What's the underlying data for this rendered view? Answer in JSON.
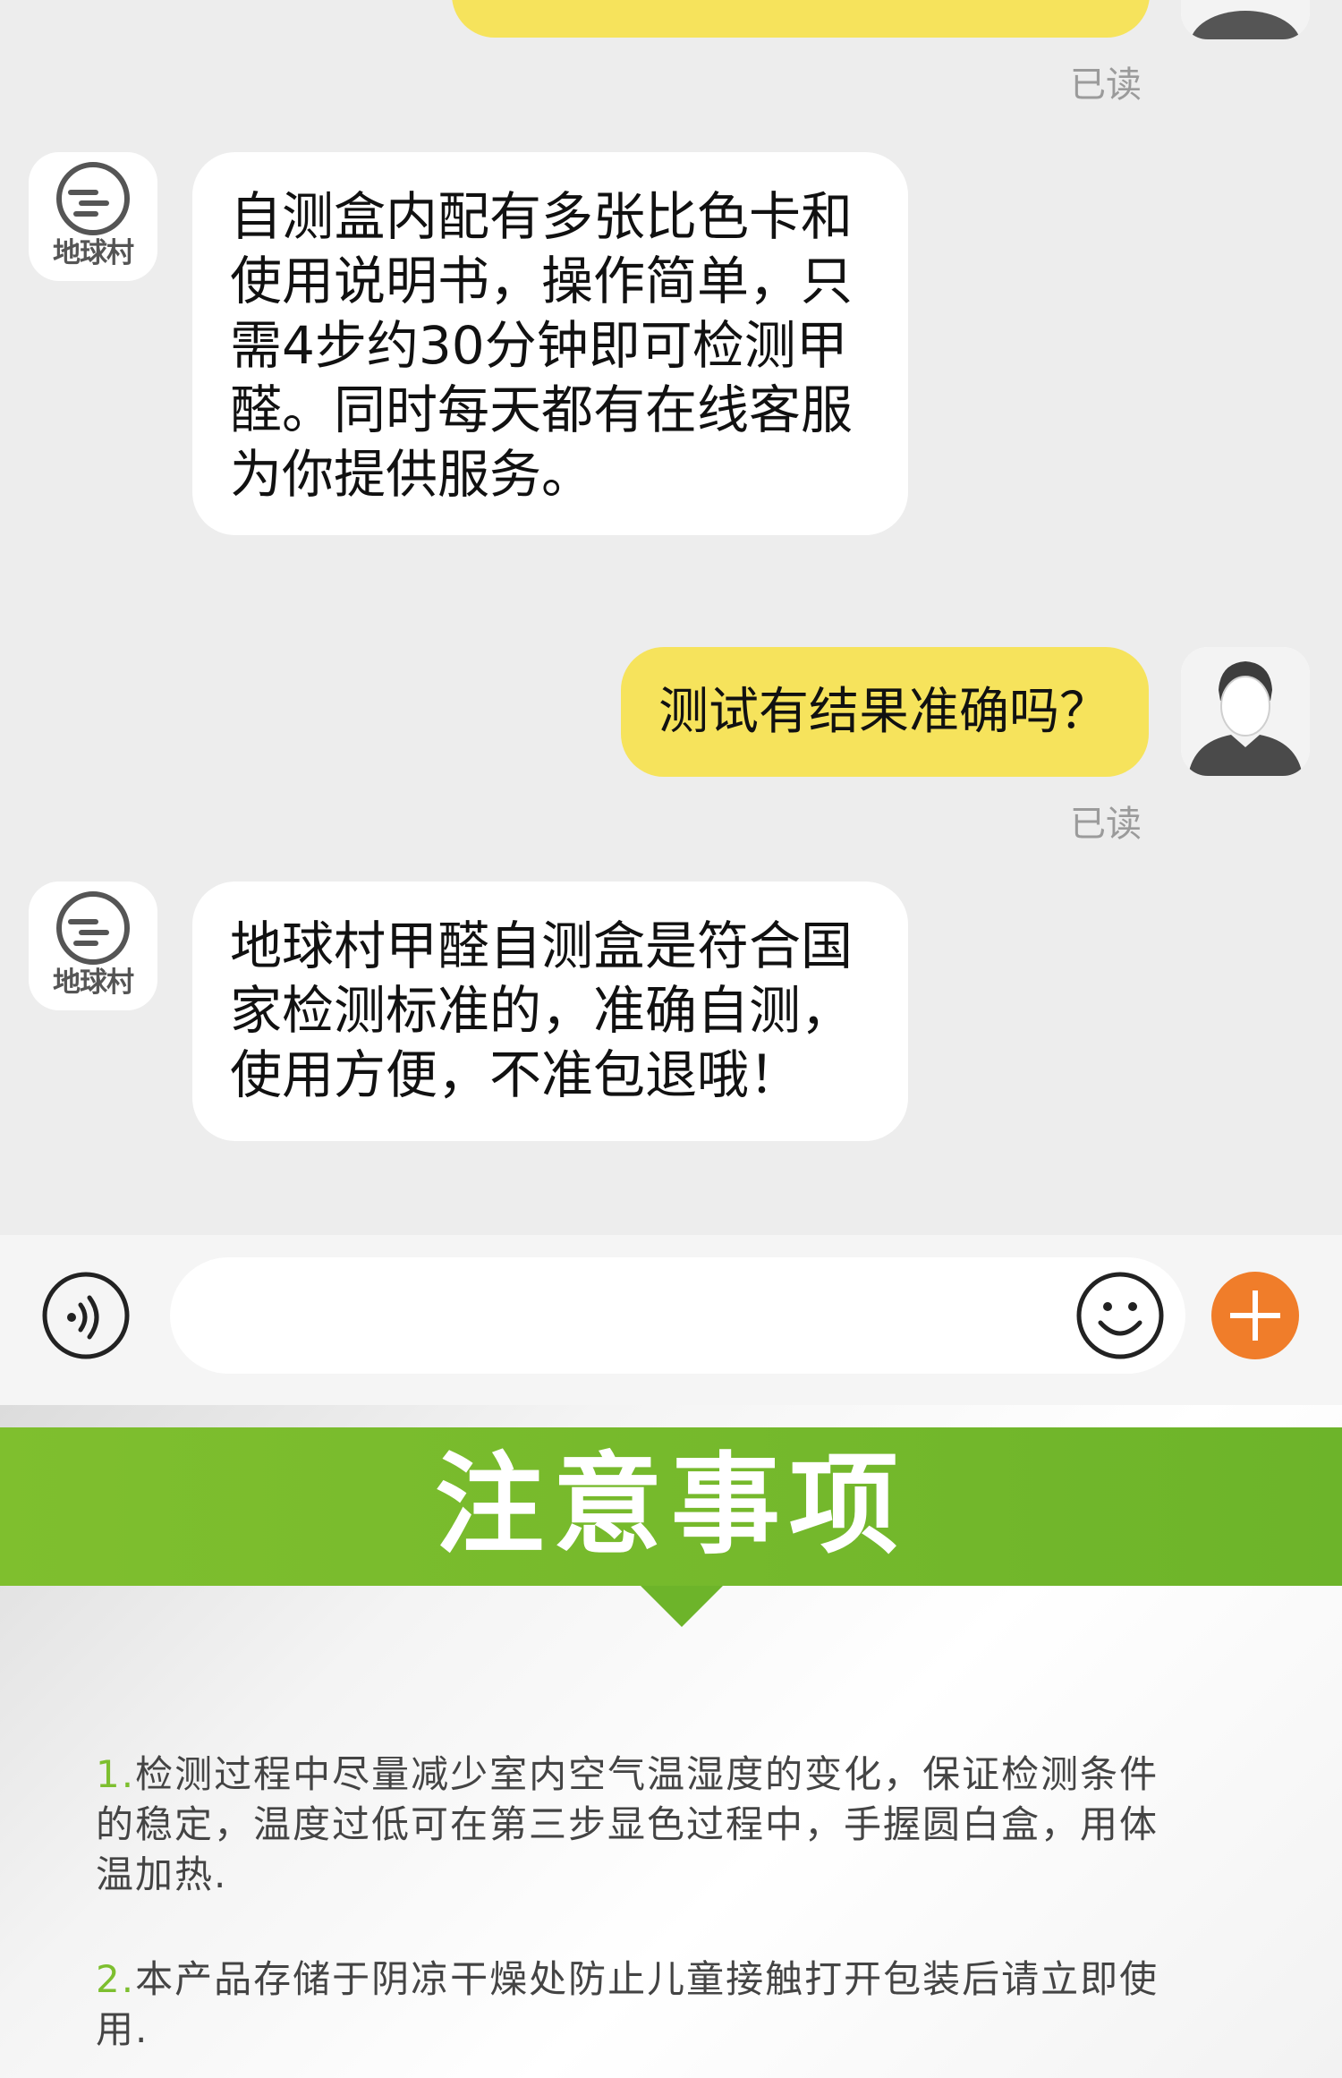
{
  "chat": {
    "messages": [
      {
        "from": "user",
        "text": "",
        "status": "已读"
      },
      {
        "from": "bot",
        "avatar_logo_text": "地球村",
        "lines": [
          "自测盒内配有多张比色卡和",
          "使用说明书，操作简单，只",
          "需4步约30分钟即可检测甲",
          "醛。同时每天都有在线客服",
          "为你提供服务。"
        ]
      },
      {
        "from": "user",
        "text": "测试有结果准确吗？",
        "status": "已读"
      },
      {
        "from": "bot",
        "avatar_logo_text": "地球村",
        "lines": [
          "地球村甲醛自测盒是符合国",
          "家检测标准的，准确自测，",
          "使用方便，不准包退哦！"
        ]
      }
    ]
  },
  "input_bar": {
    "voice_icon": "voice-icon",
    "input_placeholder": "",
    "emoji_icon": "emoji-icon",
    "plus_icon": "plus-icon"
  },
  "notes": {
    "title": "注意事项",
    "items": [
      {
        "num": "1.",
        "lines": [
          "检测过程中尽量减少室内空气温湿度的变化，保证检测条件",
          "的稳定，温度过低可在第三步显色过程中，手握圆白盒，用体",
          "温加热."
        ]
      },
      {
        "num": "2.",
        "lines": [
          "本产品存储于阴凉干燥处防止儿童接触打开包装后请立即使",
          "用."
        ]
      }
    ]
  },
  "colors": {
    "user_bubble": "#f6e35c",
    "bot_bubble": "#ffffff",
    "chat_background": "#ededed",
    "banner_green": "#7fbf2e",
    "plus_orange": "#f07d2a"
  }
}
